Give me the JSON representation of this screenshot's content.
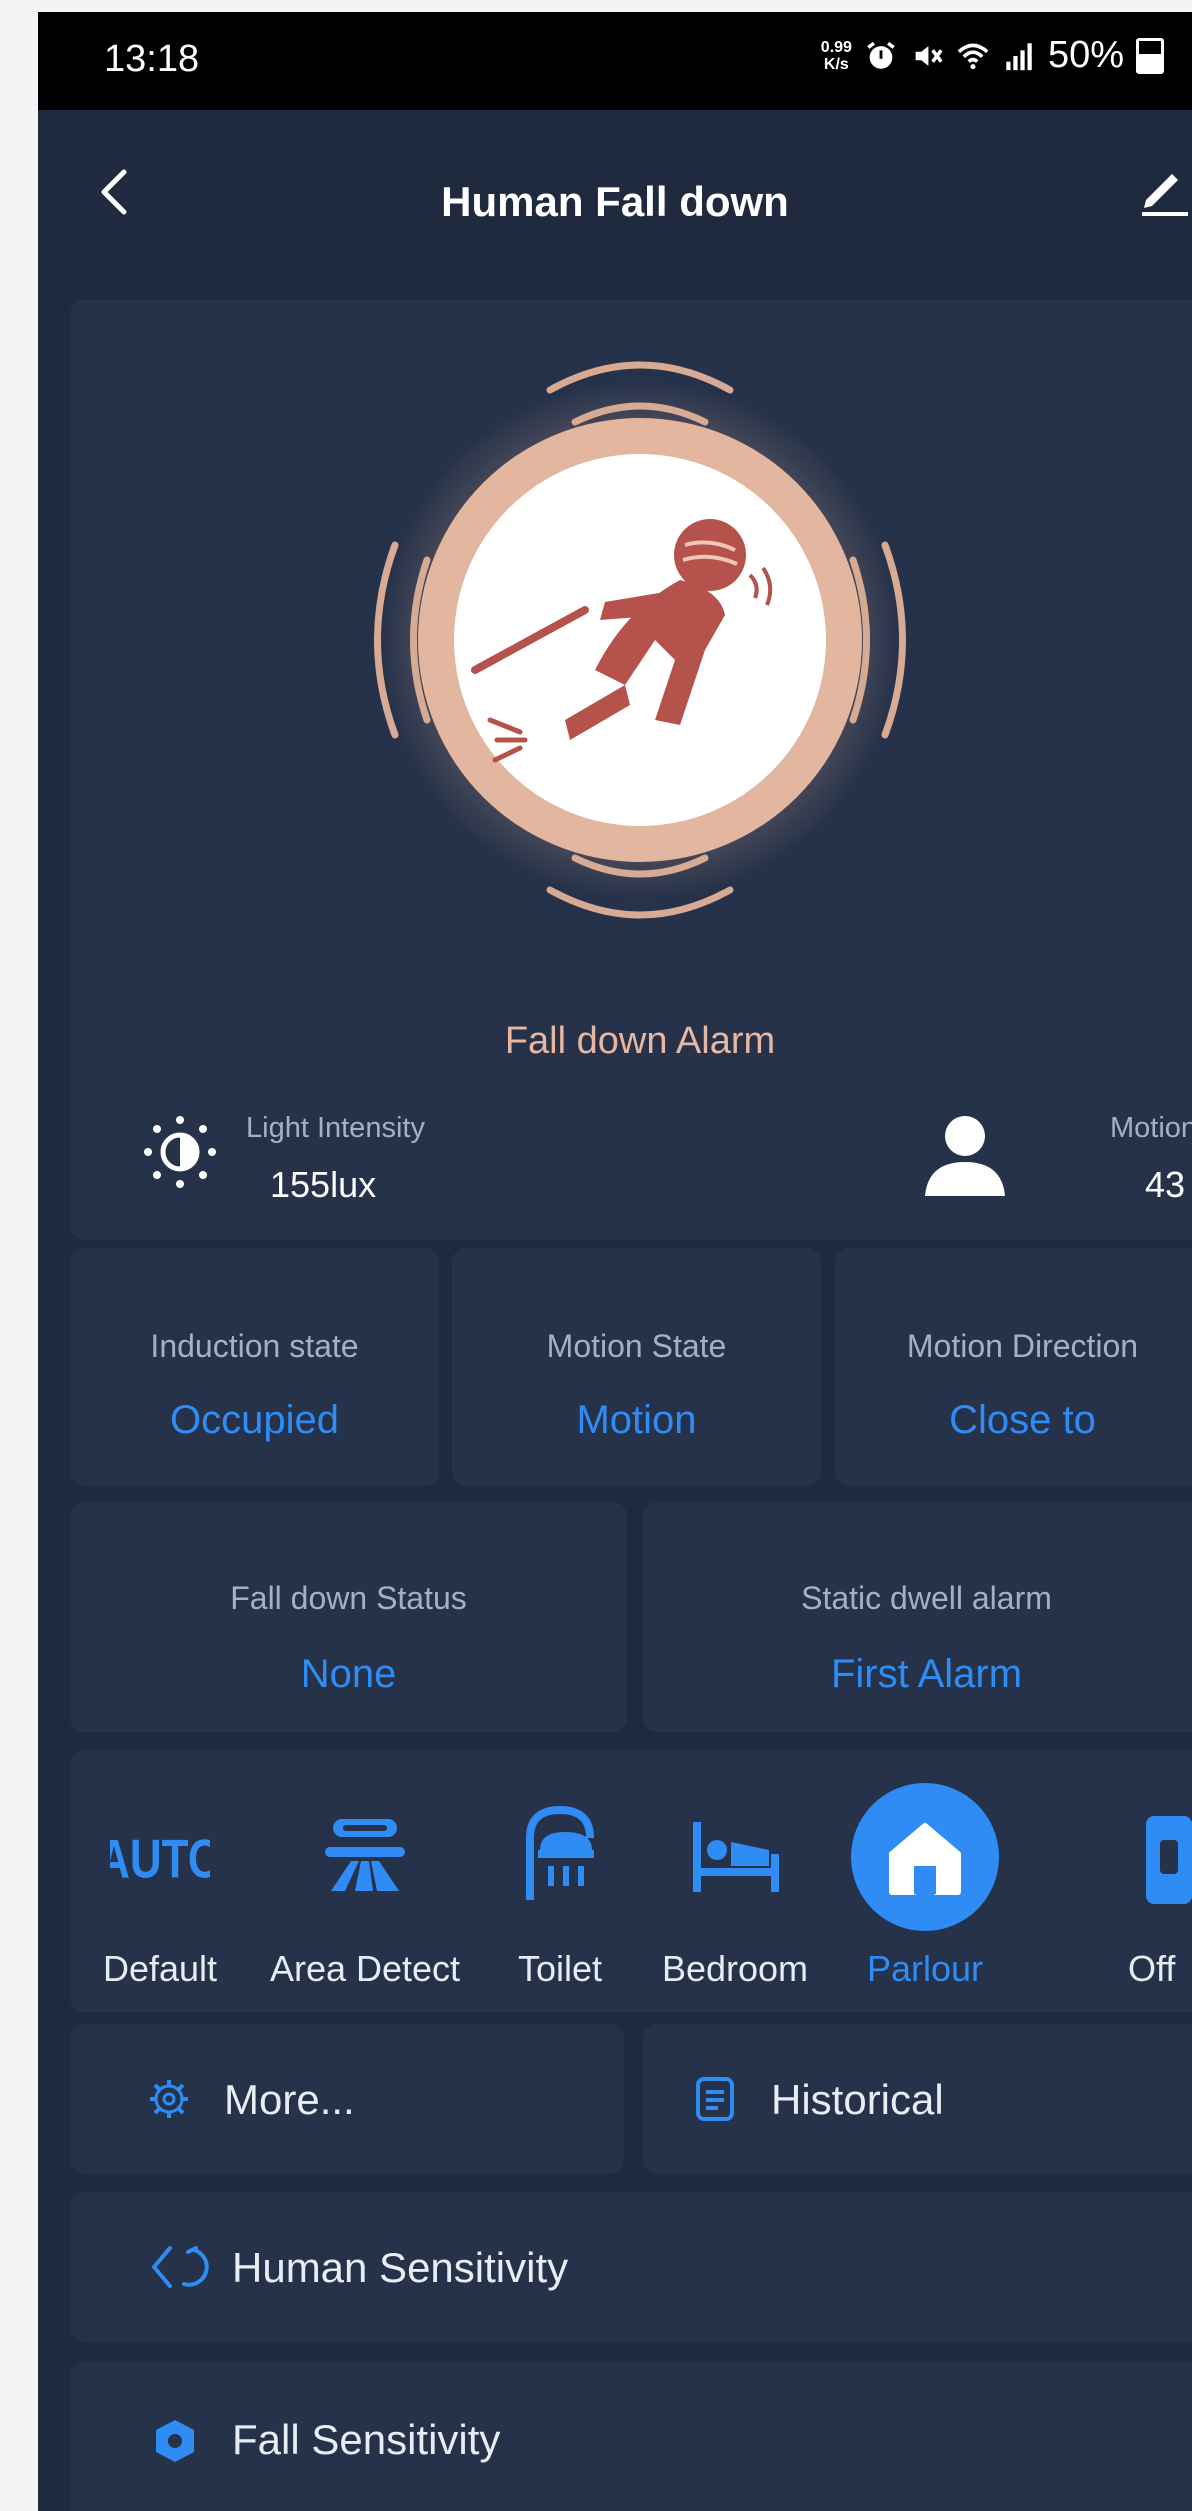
{
  "status_bar": {
    "time": "13:18",
    "net_speed_value": "0.99",
    "net_speed_unit": "K/s",
    "battery": "50%",
    "icons": [
      "alarm-icon",
      "mute-icon",
      "wifi-icon",
      "signal-5g-icon",
      "battery-icon"
    ]
  },
  "header": {
    "title": "Human Fall down",
    "back_icon": "back-arrow-icon",
    "edit_icon": "edit-pencil-icon"
  },
  "hero": {
    "alarm_text": "Fall down Alarm",
    "light": {
      "label": "Light Intensity",
      "value": "155lux",
      "icon": "sun-half-icon"
    },
    "motion": {
      "label": "Motion",
      "value": "43",
      "icon": "person-icon"
    }
  },
  "states": [
    {
      "label": "Induction state",
      "value": "Occupied"
    },
    {
      "label": "Motion State",
      "value": "Motion"
    },
    {
      "label": "Motion Direction",
      "value": "Close to"
    }
  ],
  "states2": [
    {
      "label": "Fall down Status",
      "value": "None"
    },
    {
      "label": "Static dwell alarm",
      "value": "First Alarm"
    }
  ],
  "modes": [
    {
      "label": "Default",
      "icon": "auto-icon",
      "selected": false
    },
    {
      "label": "Area Detect",
      "icon": "area-detect-icon",
      "selected": false
    },
    {
      "label": "Toilet",
      "icon": "shower-icon",
      "selected": false
    },
    {
      "label": "Bedroom",
      "icon": "bed-icon",
      "selected": false
    },
    {
      "label": "Parlour",
      "icon": "home-icon",
      "selected": true
    },
    {
      "label": "Off",
      "icon": "off-icon",
      "selected": false
    }
  ],
  "actions": {
    "more": "More...",
    "historical": "Historical",
    "human_sensitivity": "Human Sensitivity",
    "fall_sensitivity": "Fall Sensitivity"
  },
  "colors": {
    "background": "#1f2a3e",
    "card": "#26324a",
    "accent": "#2f8cf5",
    "alarm": "#e9b7a0",
    "figure": "#b5524b"
  }
}
